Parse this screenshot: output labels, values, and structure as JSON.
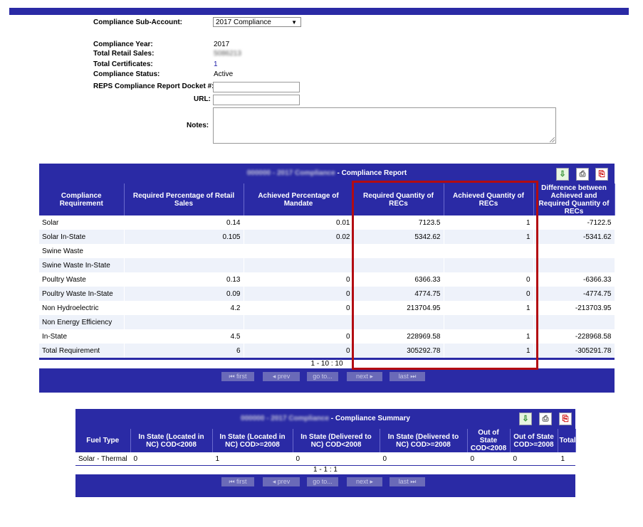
{
  "form": {
    "sub_account_label": "Compliance Sub-Account:",
    "sub_account_value": "2017 Compliance",
    "year_label": "Compliance Year:",
    "year_value": "2017",
    "retail_label": "Total Retail Sales:",
    "retail_value": "5086213",
    "certs_label": "Total Certificates:",
    "certs_value": "1",
    "status_label": "Compliance Status:",
    "status_value": "Active",
    "docket_label": "REPS Compliance Report Docket #:",
    "docket_value": "",
    "url_label": "URL:",
    "url_value": "",
    "notes_label": "Notes:",
    "notes_value": ""
  },
  "report": {
    "title_prefix": "000000 - 2017 Compliance",
    "title_suffix": " - Compliance Report",
    "columns": [
      "Compliance Requirement",
      "Required Percentage of Retail Sales",
      "Achieved Percentage of Mandate",
      "Required Quantity of RECs",
      "Achieved Quantity of RECs",
      "Difference between Achieved and Required Quantity of RECs"
    ],
    "rows": [
      [
        "Solar",
        "0.14",
        "0.01",
        "7123.5",
        "1",
        "-7122.5"
      ],
      [
        "Solar In-State",
        "0.105",
        "0.02",
        "5342.62",
        "1",
        "-5341.62"
      ],
      [
        "Swine Waste",
        "",
        "",
        "",
        "",
        ""
      ],
      [
        "Swine Waste In-State",
        "",
        "",
        "",
        "",
        ""
      ],
      [
        "Poultry Waste",
        "0.13",
        "0",
        "6366.33",
        "0",
        "-6366.33"
      ],
      [
        "Poultry Waste In-State",
        "0.09",
        "0",
        "4774.75",
        "0",
        "-4774.75"
      ],
      [
        "Non Hydroelectric",
        "4.2",
        "0",
        "213704.95",
        "1",
        "-213703.95"
      ],
      [
        "Non Energy Efficiency",
        "",
        "",
        "",
        "",
        ""
      ],
      [
        "In-State",
        "4.5",
        "0",
        "228969.58",
        "1",
        "-228968.58"
      ],
      [
        "Total Requirement",
        "6",
        "0",
        "305292.78",
        "1",
        "-305291.78"
      ]
    ],
    "page_count": "1 - 10 : 10"
  },
  "summary": {
    "title_prefix": "000000 - 2017 Compliance",
    "title_suffix": " - Compliance Summary",
    "columns": [
      "Fuel Type",
      "In State (Located in NC) COD<2008",
      "In State (Located in NC) COD>=2008",
      "In State (Delivered to NC) COD<2008",
      "In State (Delivered to NC) COD>=2008",
      "Out of State COD<2008",
      "Out of State COD>=2008",
      "Total"
    ],
    "rows": [
      [
        "Solar - Thermal",
        "0",
        "1",
        "0",
        "0",
        "0",
        "0",
        "1"
      ]
    ],
    "page_count": "1 - 1 : 1"
  },
  "pager": {
    "first": "⏮ first",
    "prev": "◂ prev",
    "goto": "go to...",
    "next": "next ▸",
    "last": "last ⏭"
  },
  "icons": {
    "export": "excel-export-icon",
    "print": "print-icon",
    "pdf": "pdf-icon"
  },
  "colors": {
    "header_blue": "#2a2aa5",
    "highlight_red": "#b30b12",
    "row_alt": "#eef2fa"
  }
}
